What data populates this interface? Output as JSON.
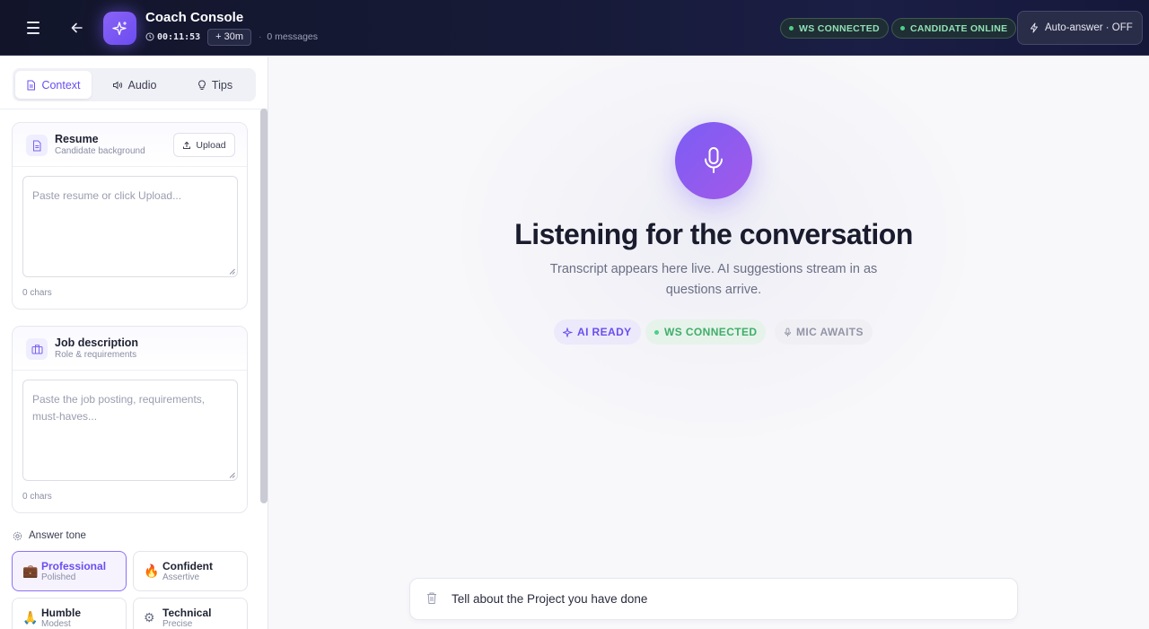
{
  "header": {
    "title": "Coach Console",
    "timer": "00:11:53",
    "add_time": "+ 30m",
    "separator": "·",
    "messages": "0 messages",
    "ws_status": "WS CONNECTED",
    "candidate_status": "CANDIDATE ONLINE",
    "auto_answer": "Auto-answer · OFF"
  },
  "sidebar": {
    "tabs": [
      {
        "label": "Context",
        "icon": "document-icon",
        "active": true
      },
      {
        "label": "Audio",
        "icon": "speaker-icon",
        "active": false
      },
      {
        "label": "Tips",
        "icon": "lightbulb-icon",
        "active": false
      }
    ],
    "resume": {
      "title": "Resume",
      "subtitle": "Candidate background",
      "upload_label": "Upload",
      "placeholder": "Paste resume or click Upload...",
      "chars": "0 chars"
    },
    "job": {
      "title": "Job description",
      "subtitle": "Role & requirements",
      "placeholder": "Paste the job posting, requirements, must-haves...",
      "chars": "0 chars"
    },
    "tone": {
      "label": "Answer tone",
      "options": [
        {
          "emoji": "💼",
          "name": "Professional",
          "desc": "Polished",
          "active": true
        },
        {
          "emoji": "🔥",
          "name": "Confident",
          "desc": "Assertive",
          "active": false
        },
        {
          "emoji": "🙏",
          "name": "Humble",
          "desc": "Modest",
          "active": false
        },
        {
          "emoji": "⚙",
          "name": "Technical",
          "desc": "Precise",
          "active": false
        }
      ]
    }
  },
  "main": {
    "headline": "Listening for the conversation",
    "subline": "Transcript appears here live. AI suggestions stream in as questions arrive.",
    "chips": {
      "ai": "AI READY",
      "ws": "WS CONNECTED",
      "mic": "MIC AWAITS"
    },
    "question": "Tell about the Project you have done"
  },
  "colors": {
    "accent": "#6a4ef0",
    "header_bg": "#161a36",
    "status_green": "#4ccf8a"
  }
}
